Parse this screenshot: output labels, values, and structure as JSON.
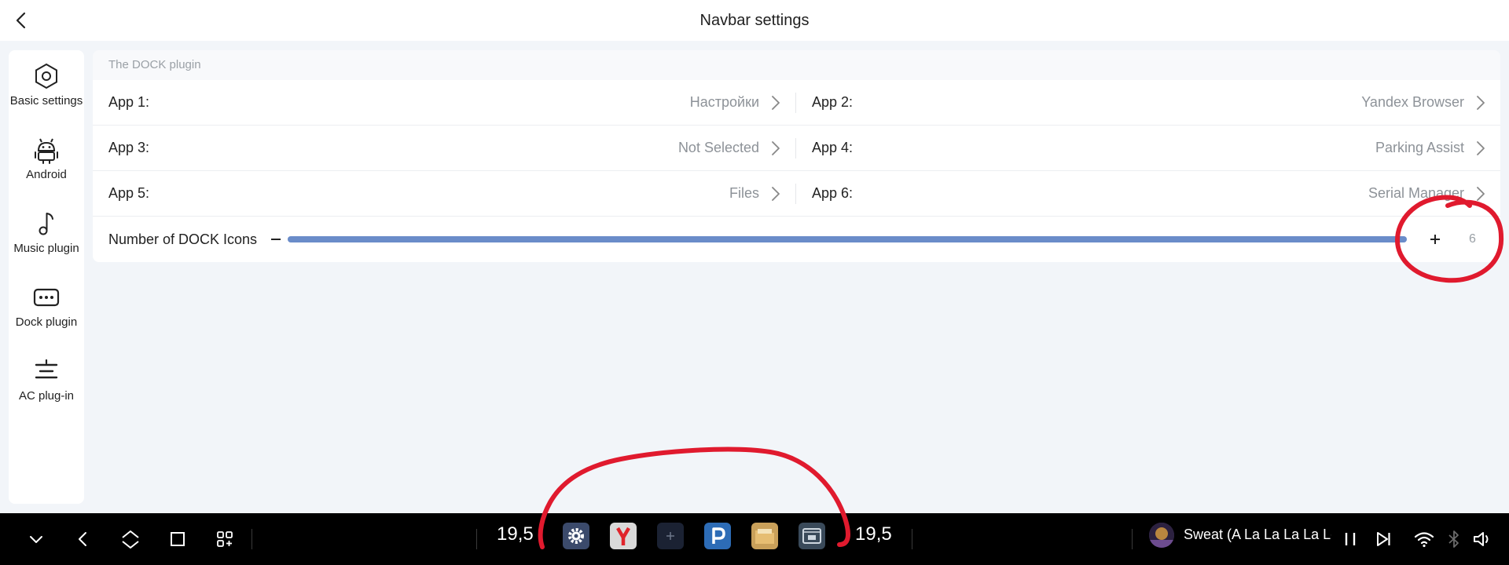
{
  "header": {
    "title": "Navbar settings"
  },
  "sidebar": {
    "items": [
      {
        "label": "Basic settings"
      },
      {
        "label": "Android"
      },
      {
        "label": "Music plugin"
      },
      {
        "label": "Dock plugin"
      },
      {
        "label": "AC plug-in"
      }
    ]
  },
  "section": {
    "title": "The DOCK plugin"
  },
  "apps": [
    {
      "key": "App 1:",
      "value": "Настройки"
    },
    {
      "key": "App 2:",
      "value": "Yandex Browser"
    },
    {
      "key": "App 3:",
      "value": "Not Selected"
    },
    {
      "key": "App 4:",
      "value": "Parking Assist"
    },
    {
      "key": "App 5:",
      "value": "Files"
    },
    {
      "key": "App 6:",
      "value": "Serial Manager"
    }
  ],
  "dock_count": {
    "label": "Number of DOCK Icons",
    "value": "6",
    "fraction": 1.0
  },
  "navbar": {
    "temp_left": "19,5",
    "temp_right": "19,5",
    "media_title": "Sweat (A La La La La Lo",
    "dock_apps": [
      {
        "icon": "settings-app-icon",
        "color": "#3b4a6b"
      },
      {
        "icon": "yandex-browser-icon",
        "color": "#d9d9d9"
      },
      {
        "icon": "add-app-icon",
        "color": "#1b2233"
      },
      {
        "icon": "parking-assist-icon",
        "color": "#2d6cb6"
      },
      {
        "icon": "files-icon",
        "color": "#c9a05a"
      },
      {
        "icon": "serial-manager-icon",
        "color": "#3a4a5a"
      }
    ]
  },
  "colors": {
    "accent": "#6a8cc9",
    "annotation": "#e01a2e",
    "navbar_bg": "#000000"
  }
}
